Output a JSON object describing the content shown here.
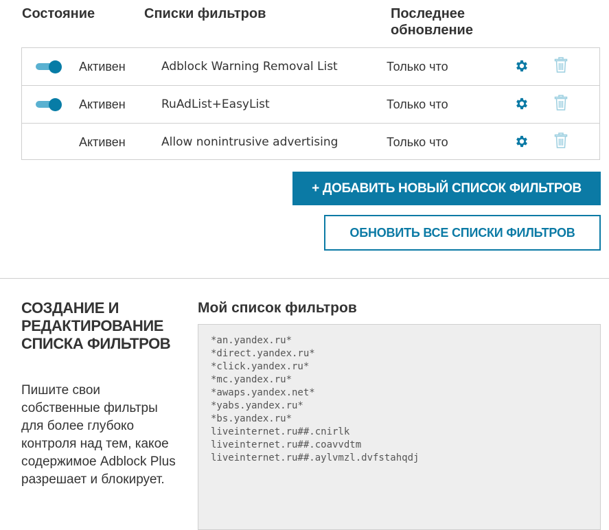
{
  "headers": {
    "status": "Состояние",
    "lists": "Списки фильтров",
    "updated": "Последнее обновление"
  },
  "rows": [
    {
      "state": "Активен",
      "name": "Adblock Warning Removal List",
      "updated": "Только что",
      "toggle_on": true
    },
    {
      "state": "Активен",
      "name": "RuAdList+EasyList",
      "updated": "Только что",
      "toggle_on": true
    },
    {
      "state": "Активен",
      "name": "Allow nonintrusive advertising",
      "updated": "Только что",
      "toggle_on": false
    }
  ],
  "buttons": {
    "add": "+ ДОБАВИТЬ НОВЫЙ СПИСОК ФИЛЬТРОВ",
    "update_all": "ОБНОВИТЬ ВСЕ СПИСКИ ФИЛЬТРОВ"
  },
  "section": {
    "title": "СОЗДАНИЕ И РЕДАКТИРОВАНИЕ СПИСКА ФИЛЬТРОВ",
    "description": "Пишите свои собственные фильтры для более глубоко контроля над тем, какое содержимое Adblock Plus разрешает и блокирует."
  },
  "my_list": {
    "label": "Мой список фильтров",
    "content": "*an.yandex.ru*\n*direct.yandex.ru*\n*click.yandex.ru*\n*mc.yandex.ru*\n*awaps.yandex.net*\n*yabs.yandex.ru*\n*bs.yandex.ru*\nliveinternet.ru##.cnirlk\nliveinternet.ru##.coavvdtm\nliveinternet.ru##.aylvmzl.dvfstahqdj"
  },
  "icons": {
    "toggle": "toggle-switch-icon",
    "settings": "gear-icon",
    "delete": "trash-icon"
  },
  "colors": {
    "accent": "#0b7aa5",
    "toggle_track": "#5ab1d1",
    "toggle_knob": "#077ca6",
    "trash": "#9ccfe0",
    "editor_bg": "#eeeeee"
  }
}
